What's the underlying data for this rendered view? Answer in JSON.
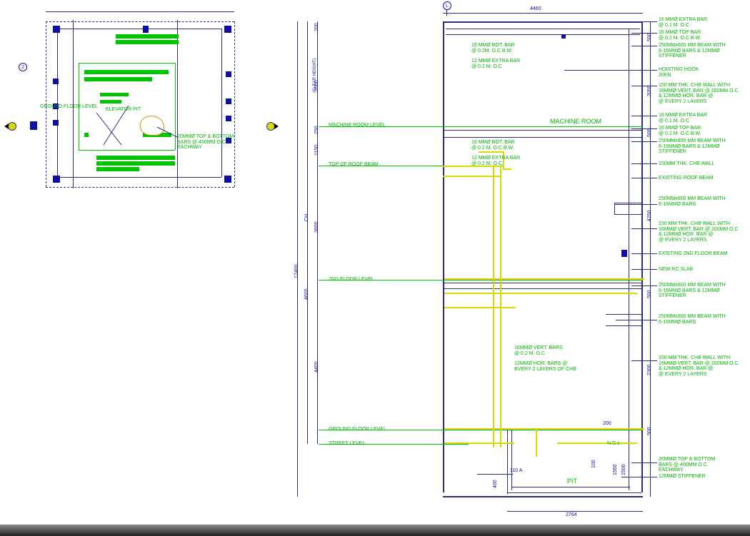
{
  "plan": {
    "ground_floor_level": "GROUND FLOOR LEVEL",
    "elevator_pit": "ELEVATOR PIT",
    "bars_note": "20MMØ TOP & BOTTOM\nBARS @ 400MM O.C\nEACHWAY"
  },
  "section": {
    "grid_label": "L",
    "dim_top": "4460",
    "dim_h_overall": "12400",
    "dim_h_clear": "(CLEAR HEIGHT)",
    "dim_h1": "200",
    "dim_h2": "2600",
    "dim_h3": "250",
    "dim_h4": "1150",
    "dim_h5": "3800",
    "dim_h6": "4400",
    "dim_h7": "4600",
    "dim_h8": "CH",
    "dim_r1": "550",
    "dim_r2": "2050",
    "dim_r3": "500",
    "dim_r4": "4250",
    "dim_r5": "550",
    "dim_r6": "2300",
    "dim_r7": "500",
    "dim_r8": "200",
    "dim_r9": "100",
    "dim_r10": "1500",
    "dim_r11": "1560",
    "dim_bottom_a": "110 A",
    "dim_bottom_b": "400",
    "dim_bottom_main": "2764",
    "labels": {
      "machine_room_level": "MACHINE ROOM LEVEL",
      "machine_room": "MACHINE ROOM",
      "top_of_roof_beam": "TOP OF ROOF BEAM",
      "second_floor_level": "2ND FLOOR LEVEL",
      "ground_floor_level": "GROUND FLOOR LEVEL",
      "street_level": "STREET LEVEL",
      "pit": "PIT",
      "ngl": "N.G.L."
    },
    "callouts_left": {
      "c1": "16 MMØ BOT. BAR\n@ 0.2M. O.C B.W.",
      "c2": "12 MMØ EXTRA BAR\n@ 0.2 M. O.C",
      "c3": "16 MMØ BOT. BAR\n@ 0.2 M. O.C B.W.",
      "c4": "12 MMØ EXTRA BAR\n@ 0.2 M. O.C",
      "c5": "16MMØ VERT. BARS\n@ 0.2 M. O.C",
      "c6": "12MMØ HOR. BARS @\nEVERY 2 LAYERS OF CHB"
    },
    "callouts_right": {
      "r1": "16 MMØ EXTRA BAR\n@ 0.1 M. O.C",
      "r2": "16 MMØ TOP BAR\n@ 0.2 M. O.C B.W.",
      "r3": "250MMx600 MM BEAM WITH\n6-16MMØ BARS & 12MMØ\nSTIFFENER",
      "r4": "HOISTING HOOK\n20KN",
      "r5": "150 MM THK. CHB WALL WITH\n16MMØ VERT. BAR @ 200MM O.C\n& 12MMØ HOR. BAR @\n@ EVERY 2 LAYERS",
      "r6": "16 MMØ EXTRA BAR\n@ 0.1 M. O.C",
      "r7": "16 MMØ TOP BAR\n@ 0.2 M. O.C B.W.",
      "r8": "250MMx855 MM BEAM WITH\n6-16MMØ BARS & 12MMØ\nSTIFFENER",
      "r9": "150MM THK. CHB WALL",
      "r10": "EXISTING ROOF BEAM",
      "r11": "250MMx800 MM BEAM WITH\n6-16MMØ BARS",
      "r12": "150 MM THK. CHB WALL WITH\n16MMØ VERT. BAR @ 200MM O.C\n& 12MMØ HOR. BAR @\n@ EVERY 2 LAYERS",
      "r13": "EXISTING 2ND FLOOR BEAM",
      "r14": "NEW RC SLAB",
      "r15": "250MMx800 MM BEAM WITH\n6-16MMØ BARS & 12MMØ\nSTIFFENER",
      "r16": "250MMx800 MM BEAM WITH\n6-16MMØ BARS",
      "r17": "150 MM THK. CHB WALL WITH\n16MMØ VERT. BAR @ 200MM O.C\n& 12MMØ HOR. BAR @\n@ EVERY 2 LAYERS",
      "r18": "20MMØ TOP & BOTTOM\nBARS @ 400MM O.C\nEACHWAY",
      "r19": "12MMØ STIFFENER"
    }
  },
  "grid_markers": {
    "two": "2"
  }
}
